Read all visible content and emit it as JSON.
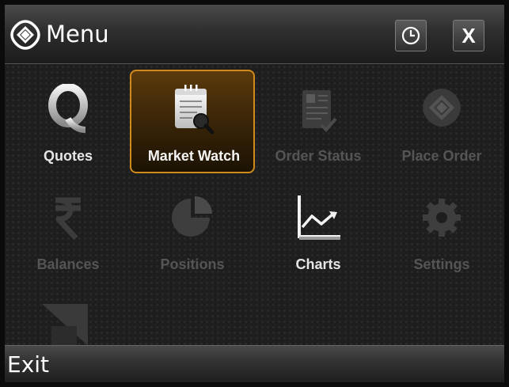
{
  "header": {
    "title": "Menu",
    "logo_icon": "app-logo-icon",
    "clock_icon": "clock-icon",
    "close_label": "X"
  },
  "menu": {
    "items": [
      {
        "label": "Quotes",
        "icon": "quotes-q-icon",
        "enabled": true
      },
      {
        "label": "Market Watch",
        "icon": "market-watch-notepad-icon",
        "enabled": true,
        "selected": true
      },
      {
        "label": "Order Status",
        "icon": "order-status-icon",
        "enabled": false
      },
      {
        "label": "Place Order",
        "icon": "place-order-icon",
        "enabled": false
      },
      {
        "label": "Balances",
        "icon": "rupee-icon",
        "enabled": false
      },
      {
        "label": "Positions",
        "icon": "pie-chart-icon",
        "enabled": false
      },
      {
        "label": "Charts",
        "icon": "line-chart-icon",
        "enabled": true
      },
      {
        "label": "Settings",
        "icon": "gear-icon",
        "enabled": false
      },
      {
        "label": "",
        "icon": "scroll-more-icon",
        "enabled": false
      }
    ]
  },
  "softkeys": {
    "left": "Exit"
  },
  "colors": {
    "selection_border": "#d08a1c",
    "selection_fill": "#5b3a0c",
    "enabled_text": "#e6e6e6",
    "disabled_text": "#555555"
  }
}
